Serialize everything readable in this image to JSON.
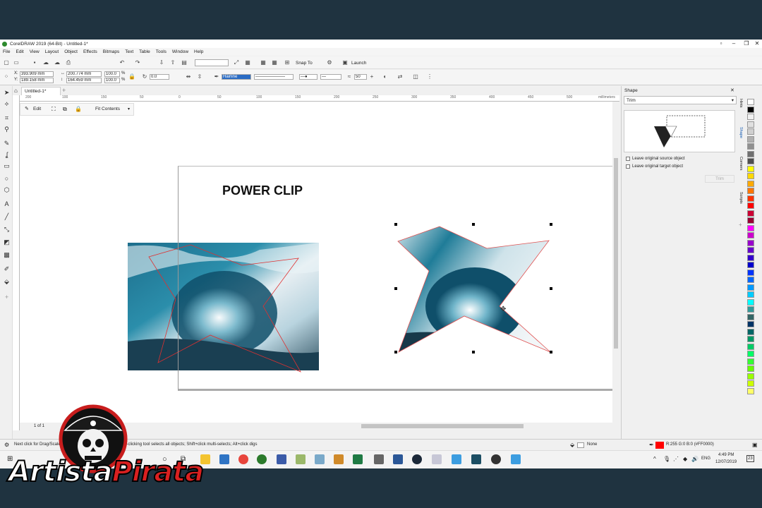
{
  "app": {
    "title": "CorelDRAW 2019 (64-Bit) - Untitled-1*",
    "menu": [
      "File",
      "Edit",
      "View",
      "Layout",
      "Object",
      "Effects",
      "Bitmaps",
      "Text",
      "Table",
      "Tools",
      "Window",
      "Help"
    ]
  },
  "toolbar1": {
    "snap_to": "Snap To",
    "launch": "Launch"
  },
  "property_bar": {
    "x": "393.909 mm",
    "y": "189.158 mm",
    "width": "200.774 mm",
    "height": "164.459 mm",
    "scale_x": "100.0",
    "scale_y": "100.0",
    "pct": "%",
    "rotation": "0.0",
    "outline_width": "Hairline",
    "smoothing": "50"
  },
  "document": {
    "tab_name": "Untitled-1*"
  },
  "ruler": {
    "units": "millimeters",
    "ticks": [
      "200",
      "150",
      "100",
      "50",
      "0",
      "50",
      "100",
      "150",
      "200",
      "250",
      "300",
      "350",
      "400",
      "450",
      "500"
    ]
  },
  "powerclip_toolbar": {
    "edit": "Edit",
    "fit": "Fit Contents"
  },
  "canvas": {
    "heading": "POWER CLIP"
  },
  "shaping_docker": {
    "header": "Shape",
    "mode": "Trim",
    "option1": "Leave original source object",
    "option2": "Leave original target object",
    "apply": "Trim",
    "tabs": [
      "Hints",
      "Shape",
      "Corners",
      "Scripts"
    ]
  },
  "palette": [
    "#ffffff",
    "#000000",
    "#f0f0f0",
    "#e0e0e0",
    "#d0d0d0",
    "#b0b0b0",
    "#909090",
    "#707070",
    "#505050",
    "#ffff00",
    "#ffd800",
    "#ffaa00",
    "#ff7700",
    "#ff3300",
    "#ff0000",
    "#cc0033",
    "#990033",
    "#ff00ff",
    "#cc00cc",
    "#9900cc",
    "#6600cc",
    "#3300cc",
    "#0000cc",
    "#0033ff",
    "#0066ff",
    "#0099ff",
    "#00ccff",
    "#00ffff",
    "#339999",
    "#336666",
    "#003366",
    "#006666",
    "#009966",
    "#00cc66",
    "#00ff66",
    "#33ff33",
    "#66ff00",
    "#99ff00",
    "#ccff00",
    "#ffff66"
  ],
  "statusbar": {
    "hint": "Next click for Drag/Scale; Second click for Rotate/Skew; Dbl-clicking tool selects all objects; Shift+click multi-selects; Alt+click digs",
    "fill": "None",
    "outline": "R:255 G:0 B:0 (#FF0000)",
    "page_label": "1 of 1"
  },
  "taskbar": {
    "time": "4:49 PM",
    "date": "12/07/2019",
    "lang": "ENG",
    "notif": "23"
  },
  "watermark": {
    "brand": "ArtistaPirata"
  }
}
